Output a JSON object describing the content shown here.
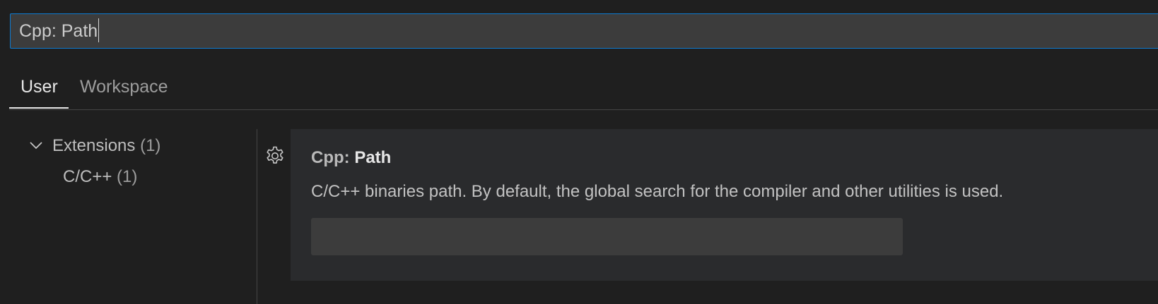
{
  "search": {
    "value": "Cpp: Path"
  },
  "tabs": [
    {
      "label": "User",
      "active": true
    },
    {
      "label": "Workspace",
      "active": false
    }
  ],
  "toc": {
    "items": [
      {
        "label": "Extensions",
        "count": "(1)"
      },
      {
        "label": "C/C++",
        "count": "(1)"
      }
    ]
  },
  "setting": {
    "category": "Cpp: ",
    "name": "Path",
    "description": "C/C++ binaries path. By default, the global search for the compiler and other utilities is used.",
    "value": ""
  },
  "icons": {
    "toc_chevron": "chevron-down-icon",
    "setting_gear": "gear-icon"
  },
  "colors": {
    "background": "#1f1f1f",
    "focus_border": "#0e7ad0",
    "input_background": "#3c3c3c",
    "setting_background": "#2a2b2d"
  }
}
